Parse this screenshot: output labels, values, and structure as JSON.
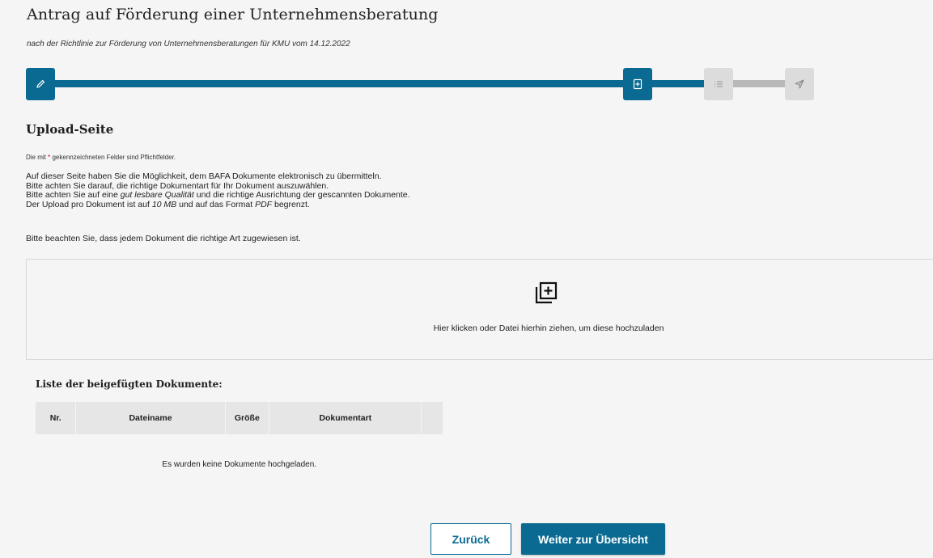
{
  "header": {
    "title": "Antrag auf Förderung einer Unternehmensberatung",
    "subtitle": "nach der Richtlinie zur Förderung von Unternehmensberatungen für KMU vom 14.12.2022"
  },
  "progress": {
    "current_step": 2,
    "total_steps": 4,
    "steps": [
      {
        "icon": "pencil-icon",
        "state": "completed"
      },
      {
        "icon": "upload-document-icon",
        "state": "current"
      },
      {
        "icon": "list-icon",
        "state": "upcoming"
      },
      {
        "icon": "send-icon",
        "state": "upcoming"
      }
    ],
    "colors": {
      "active": "#0a6a92",
      "inactive": "#dcdcdc"
    }
  },
  "section": {
    "title": "Upload-Seite",
    "required_note_prefix": "Die mit ",
    "required_star": "*",
    "required_note_suffix": " gekennzeichneten Felder sind Pflichtfelder."
  },
  "info": {
    "line1": "Auf dieser Seite haben Sie die Möglichkeit, dem BAFA Dokumente elektronisch zu übermitteln.",
    "line2": "Bitte achten Sie darauf, die richtige Dokumentart für Ihr Dokument auszuwählen.",
    "line3_a": "Bitte achten Sie auf eine ",
    "line3_em": "gut lesbare Qualität",
    "line3_b": " und die richtige Ausrichtung der gescannten Dokumente.",
    "line4_a": "Der Upload pro Dokument ist auf ",
    "line4_em1": "10 MB",
    "line4_b": " und auf das Format ",
    "line4_em2": "PDF",
    "line4_c": " begrenzt.",
    "note": "Bitte beachten Sie, dass jedem Dokument die richtige Art zugewiesen ist."
  },
  "dropzone": {
    "icon": "add-file-icon",
    "hint": "Hier klicken oder Datei hierhin ziehen, um diese hochzuladen"
  },
  "documents": {
    "title": "Liste der beigefügten Dokumente:",
    "columns": [
      "Nr.",
      "Dateiname",
      "Größe",
      "Dokumentart",
      ""
    ],
    "rows": [],
    "empty_text": "Es wurden keine Dokumente hochgeladen."
  },
  "buttons": {
    "back": "Zurück",
    "next": "Weiter zur Übersicht"
  }
}
